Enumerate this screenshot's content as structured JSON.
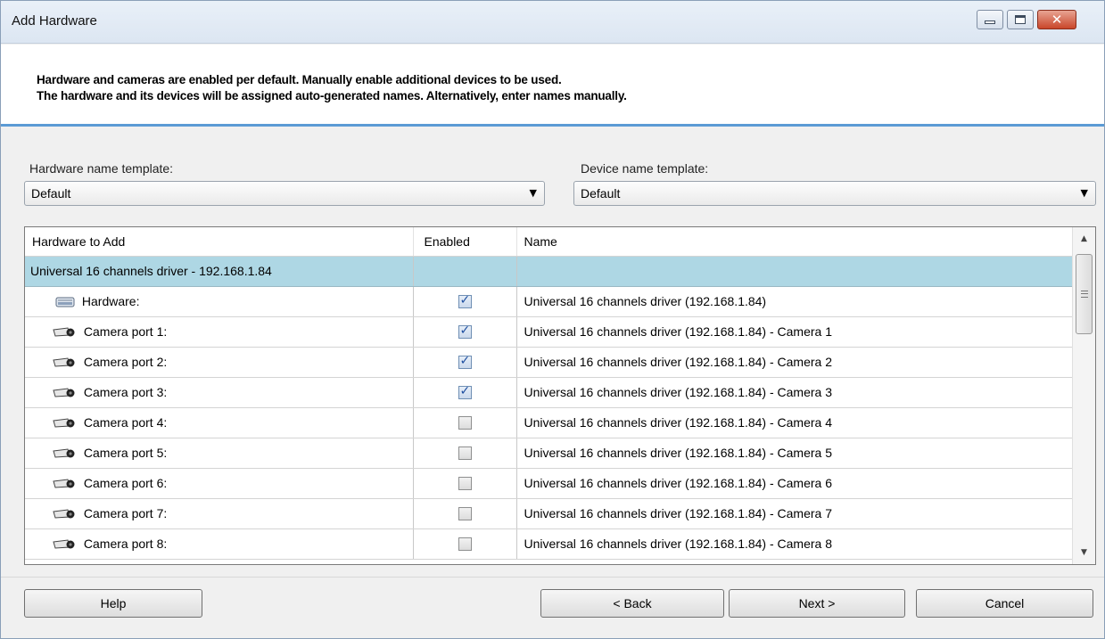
{
  "window": {
    "title": "Add Hardware",
    "controls": {
      "minimize_icon": "minimize-icon",
      "maximize_icon": "maximize-icon",
      "close_icon": "close-icon",
      "close_glyph": "✕"
    }
  },
  "header": {
    "line1": "Hardware and cameras are enabled per default. Manually enable additional devices to be used.",
    "line2": "The hardware and its devices will be assigned auto-generated names. Alternatively, enter names manually."
  },
  "templates": {
    "hardware_label": "Hardware name template:",
    "hardware_value": "Default",
    "device_label": "Device name template:",
    "device_value": "Default",
    "arrow": "▼"
  },
  "grid": {
    "columns": [
      "Hardware to Add",
      "Enabled",
      "Name"
    ],
    "group": "Universal 16 channels driver - 192.168.1.84",
    "rows": [
      {
        "icon": "hardware-icon",
        "label": "Hardware:",
        "enabled": true,
        "name": "Universal 16 channels driver (192.168.1.84)"
      },
      {
        "icon": "camera-icon",
        "label": "Camera port 1:",
        "enabled": true,
        "name": "Universal 16 channels driver (192.168.1.84) - Camera 1"
      },
      {
        "icon": "camera-icon",
        "label": "Camera port 2:",
        "enabled": true,
        "name": "Universal 16 channels driver (192.168.1.84) - Camera 2"
      },
      {
        "icon": "camera-icon",
        "label": "Camera port 3:",
        "enabled": true,
        "name": "Universal 16 channels driver (192.168.1.84) - Camera 3"
      },
      {
        "icon": "camera-icon",
        "label": "Camera port 4:",
        "enabled": false,
        "name": "Universal 16 channels driver (192.168.1.84) - Camera 4"
      },
      {
        "icon": "camera-icon",
        "label": "Camera port 5:",
        "enabled": false,
        "name": "Universal 16 channels driver (192.168.1.84) - Camera 5"
      },
      {
        "icon": "camera-icon",
        "label": "Camera port 6:",
        "enabled": false,
        "name": "Universal 16 channels driver (192.168.1.84) - Camera 6"
      },
      {
        "icon": "camera-icon",
        "label": "Camera port 7:",
        "enabled": false,
        "name": "Universal 16 channels driver (192.168.1.84) - Camera 7"
      },
      {
        "icon": "camera-icon",
        "label": "Camera port 8:",
        "enabled": false,
        "name": "Universal 16 channels driver (192.168.1.84) - Camera 8"
      }
    ],
    "scroll": {
      "up": "▲",
      "down": "▼"
    }
  },
  "footer": {
    "help": "Help",
    "back": "< Back",
    "next": "Next >",
    "cancel": "Cancel"
  },
  "colors": {
    "group_row": "#aed7e4",
    "header_rule": "#5b9bd5",
    "check": "#1f4fa0"
  }
}
